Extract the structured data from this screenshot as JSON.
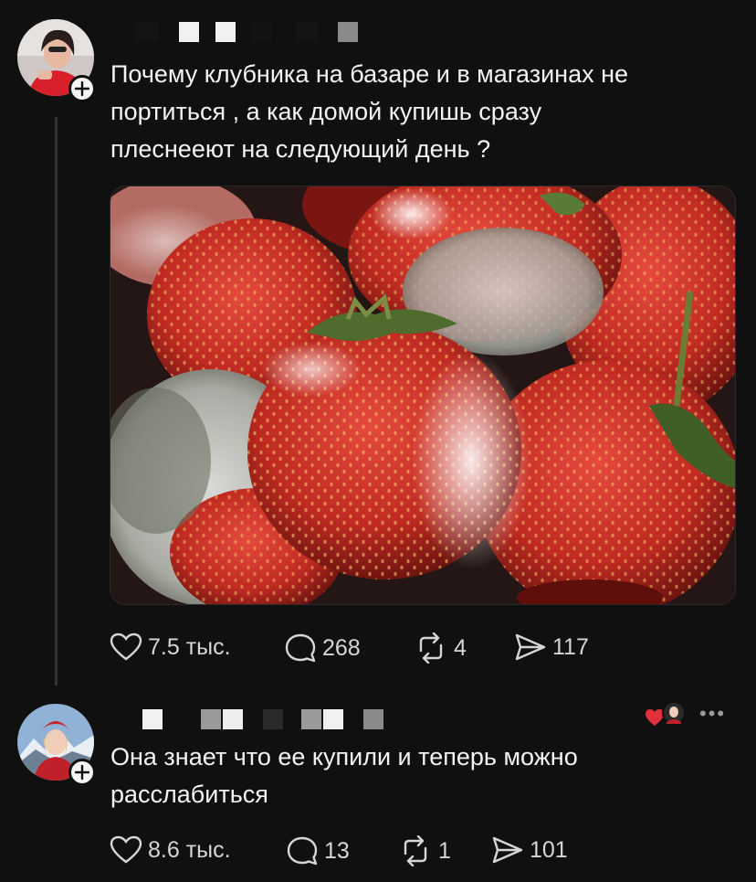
{
  "post": {
    "text": "Почему клубника на базаре и в магазинах не\nпортиться , а как домой купишь сразу\nплеснееют на следующий день ?",
    "image_alt": "moldy strawberries",
    "stats": {
      "likes": "7.5 тыс.",
      "comments": "268",
      "reposts": "4",
      "shares": "117"
    }
  },
  "reply": {
    "text": "Она знает что ее купили и теперь можно\nрасслабиться",
    "more_label": "•••",
    "stats": {
      "likes": "8.6 тыс.",
      "comments": "13",
      "reposts": "1",
      "shares": "101"
    }
  },
  "colors": {
    "background": "#101010",
    "text": "#f3f3f3",
    "muted": "#d6d6d6",
    "heart_accent": "#e0303c"
  }
}
